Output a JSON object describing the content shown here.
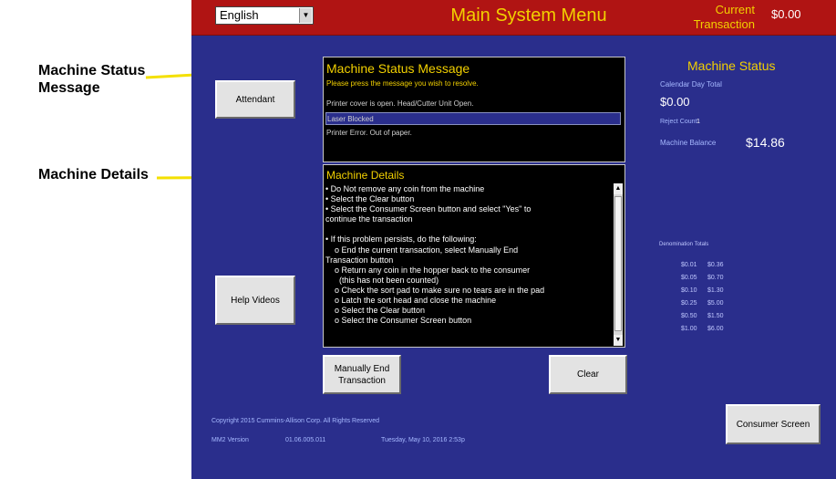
{
  "callouts": {
    "status_message": [
      "Machine Status",
      "Message"
    ],
    "details": "Machine Details"
  },
  "header": {
    "language": "English",
    "title": "Main System Menu",
    "current_transaction_label": [
      "Current",
      "Transaction"
    ],
    "current_transaction_amount": "$0.00"
  },
  "buttons": {
    "attendant": "Attendant",
    "help_videos": "Help Videos",
    "manually_end": [
      "Manually End",
      "Transaction"
    ],
    "clear": "Clear",
    "consumer_screen": "Consumer Screen"
  },
  "status_message": {
    "title": "Machine Status Message",
    "subtitle": "Please press the message you wish to resolve.",
    "messages": [
      "Printer cover is open. Head/Cutter Unit Open.",
      "Laser Blocked",
      "Printer Error.  Out of paper."
    ],
    "selected_index": 1
  },
  "details": {
    "title": "Machine Details",
    "lines": [
      "• Do Not remove any coin from the machine",
      "• Select the Clear button",
      "• Select the Consumer Screen button and select \"Yes\" to",
      "continue the transaction",
      "",
      "• If this problem persists, do the following:",
      "    o End the current transaction, select Manually End",
      "Transaction button",
      "    o Return any coin in the hopper back to the consumer",
      "      (this has not been counted)",
      "    o Check the sort pad to make sure no tears are in the pad",
      "    o Latch the sort head and close the machine",
      "    o Select the Clear button",
      "    o Select the Consumer Screen button"
    ]
  },
  "machine_status": {
    "title": "Machine Status",
    "calendar_day_total_label": "Calendar Day Total",
    "calendar_day_total": "$0.00",
    "reject_count_label": "Reject Count",
    "reject_count": "1",
    "machine_balance_label": "Machine Balance",
    "machine_balance": "$14.86",
    "denomination_totals_label": "Denomination Totals",
    "denominations": [
      {
        "denom": "$0.01",
        "total": "$0.36"
      },
      {
        "denom": "$0.05",
        "total": "$0.70"
      },
      {
        "denom": "$0.10",
        "total": "$1.30"
      },
      {
        "denom": "$0.25",
        "total": "$5.00"
      },
      {
        "denom": "$0.50",
        "total": "$1.50"
      },
      {
        "denom": "$1.00",
        "total": "$6.00"
      }
    ]
  },
  "footer": {
    "copyright": "Copyright 2015 Cummins-Allison Corp. All Rights Reserved",
    "version_label": "MM2 Version",
    "version": "01.06.005.011",
    "datetime": "Tuesday, May 10, 2016 2:53p"
  },
  "colors": {
    "background": "#2a2e8c",
    "header": "#b01413",
    "accent_yellow": "#f2d000",
    "arrow_yellow": "#f4e000"
  }
}
